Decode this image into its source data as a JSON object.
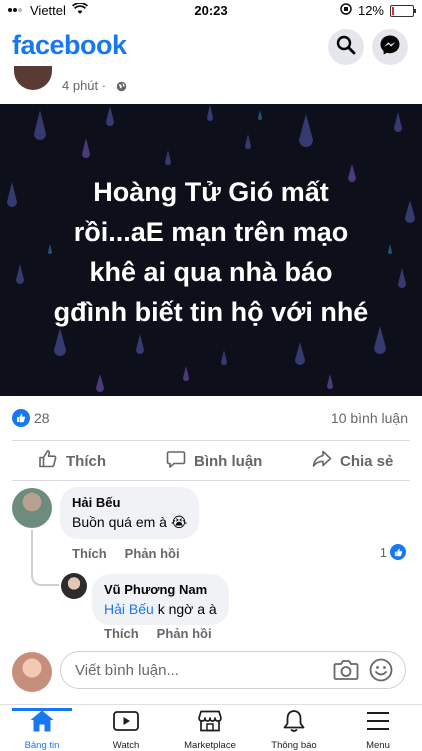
{
  "status_bar": {
    "carrier": "Viettel",
    "time": "20:23",
    "battery": "12%",
    "battery_fraction": 0.12
  },
  "header": {
    "logo": "facebook"
  },
  "post": {
    "time": "4 phút ·",
    "image_text": [
      "Hoàng Tử Gió mất",
      "rồi...aE mạn trên mạo",
      "khê ai qua nhà báo",
      "gđình biết tin hộ với nhé"
    ],
    "likes": "28",
    "comments_count": "10 bình luận",
    "actions": {
      "like": "Thích",
      "comment": "Bình luận",
      "share": "Chia sẻ"
    }
  },
  "comments": [
    {
      "name": "Hải Bếu",
      "text": "Buồn quá em à",
      "emoji": "😭",
      "actions": {
        "like": "Thích",
        "reply": "Phản hồi"
      },
      "reactions": "1",
      "replies": [
        {
          "name": "Vũ Phương Nam",
          "mention": "Hải Bếu",
          "text": " k ngờ a à",
          "actions": {
            "like": "Thích",
            "reply": "Phản hồi"
          }
        }
      ]
    }
  ],
  "write_comment": {
    "placeholder": "Viết bình luận..."
  },
  "bottom_nav": [
    {
      "label": "Bảng tin",
      "icon": "home-icon",
      "active": true
    },
    {
      "label": "Watch",
      "icon": "watch-icon"
    },
    {
      "label": "Marketplace",
      "icon": "marketplace-icon"
    },
    {
      "label": "Thông báo",
      "icon": "bell-icon"
    },
    {
      "label": "Menu",
      "icon": "menu-icon"
    }
  ],
  "colors": {
    "brand": "#1877f2",
    "secondary_text": "#65676b",
    "bubble": "#f0f2f5",
    "image_bg": "#0d0f1a"
  }
}
